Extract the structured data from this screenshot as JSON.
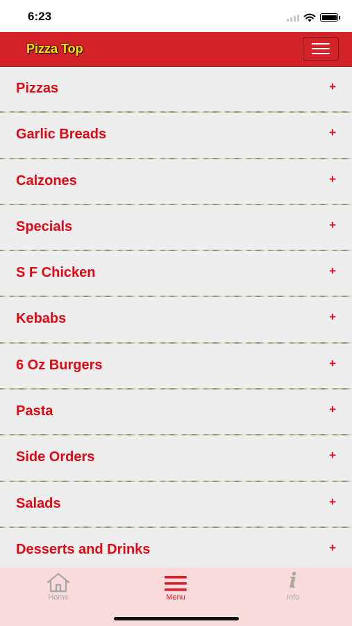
{
  "status_bar": {
    "time": "6:23"
  },
  "header": {
    "title": "Pizza Top",
    "menu_icon": "hamburger-icon"
  },
  "colors": {
    "header_bg": "#d42229",
    "title": "#ffe600",
    "item_text": "#e30613",
    "list_bg": "#eeeeee",
    "tab_bar_bg": "#fadada",
    "tab_active": "#d42229",
    "tab_inactive": "#a8a8a8"
  },
  "menu": {
    "items": [
      {
        "label": "Pizzas",
        "expand": "+"
      },
      {
        "label": "Garlic Breads",
        "expand": "+"
      },
      {
        "label": "Calzones",
        "expand": "+"
      },
      {
        "label": "Specials",
        "expand": "+"
      },
      {
        "label": "S F Chicken",
        "expand": "+"
      },
      {
        "label": "Kebabs",
        "expand": "+"
      },
      {
        "label": "6 Oz Burgers",
        "expand": "+"
      },
      {
        "label": "Pasta",
        "expand": "+"
      },
      {
        "label": "Side Orders",
        "expand": "+"
      },
      {
        "label": "Salads",
        "expand": "+"
      },
      {
        "label": "Desserts and Drinks",
        "expand": "+"
      }
    ]
  },
  "tabs": [
    {
      "label": "Home",
      "icon": "home-icon",
      "active": false
    },
    {
      "label": "Menu",
      "icon": "menu-icon",
      "active": true
    },
    {
      "label": "Info",
      "icon": "info-icon",
      "active": false
    }
  ]
}
